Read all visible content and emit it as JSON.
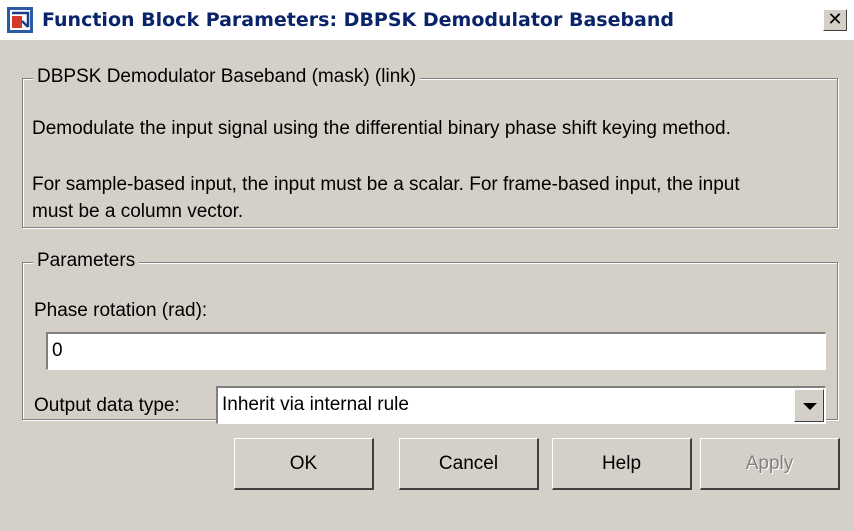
{
  "window": {
    "title": "Function Block Parameters: DBPSK Demodulator Baseband",
    "close_symbol": "✕",
    "icon": "simulink-block-icon"
  },
  "description": {
    "group_label": "DBPSK Demodulator Baseband (mask) (link)",
    "line1": "Demodulate the input signal using the differential binary phase shift keying method.",
    "line2a": "For sample-based input, the input must be a scalar. For frame-based input, the input",
    "line2b": "must be a column vector."
  },
  "parameters": {
    "group_label": "Parameters",
    "phase_label": "Phase rotation (rad):",
    "phase_value": "0",
    "output_label": "Output data type:",
    "output_value": "Inherit via internal rule"
  },
  "buttons": {
    "ok": "OK",
    "cancel": "Cancel",
    "help": "Help",
    "apply": "Apply"
  }
}
